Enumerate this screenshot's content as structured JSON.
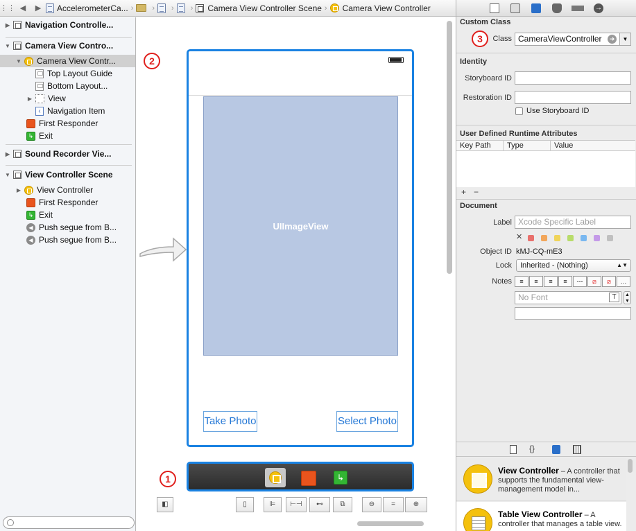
{
  "jumpbar": {
    "items": [
      "AccelerometerCa...",
      "",
      "",
      "",
      "Camera View Controller Scene",
      "Camera View Controller"
    ]
  },
  "outline": {
    "scenes": [
      {
        "label": "Navigation Controlle..."
      },
      {
        "label": "Camera View Contro..."
      },
      {
        "label": "Sound Recorder Vie..."
      },
      {
        "label": "View Controller Scene"
      }
    ],
    "items": {
      "camera_vc": "Camera View Contr...",
      "top_layout": "Top Layout Guide",
      "bottom_layout": "Bottom Layout...",
      "view": "View",
      "nav_item": "Navigation Item",
      "first_responder_1": "First Responder",
      "exit_1": "Exit",
      "view_controller": "View Controller",
      "first_responder_2": "First Responder",
      "exit_2": "Exit",
      "segue_1": "Push segue from B...",
      "segue_2": "Push segue from B..."
    }
  },
  "canvas": {
    "image_view_label": "UIImageView",
    "take_photo": "Take Photo",
    "select_photo": "Select Photo",
    "badges": [
      "1",
      "2",
      "3"
    ]
  },
  "inspector": {
    "custom_class": {
      "heading": "Custom Class",
      "class_label": "Class",
      "class_value": "CameraViewController"
    },
    "identity": {
      "heading": "Identity",
      "storyboard_id_label": "Storyboard ID",
      "storyboard_id_value": "",
      "restoration_id_label": "Restoration ID",
      "restoration_id_value": "",
      "use_storyboard_id": "Use Storyboard ID"
    },
    "runtime_attrs": {
      "heading": "User Defined Runtime Attributes",
      "columns": [
        "Key Path",
        "Type",
        "Value"
      ],
      "add": "+",
      "remove": "−"
    },
    "document": {
      "heading": "Document",
      "label_label": "Label",
      "label_placeholder": "Xcode Specific Label",
      "object_id_label": "Object ID",
      "object_id_value": "kMJ-CQ-mE3",
      "lock_label": "Lock",
      "lock_value": "Inherited - (Nothing)",
      "notes_label": "Notes",
      "font_placeholder": "No Font",
      "swatch_colors": [
        "#e8706c",
        "#f2a65a",
        "#f0d45a",
        "#b8dc6a",
        "#7ab8f0",
        "#c49ae8",
        "#c0c0c0"
      ]
    },
    "library": {
      "items": [
        {
          "title": "View Controller",
          "desc": " – A controller that supports the fundamental view-management model in..."
        },
        {
          "title": "Table View Controller",
          "desc": " – A controller that manages a table view."
        }
      ]
    }
  },
  "colors": {
    "selection_blue": "#1a82e2",
    "image_view_fill": "#b8c8e3",
    "badge_red": "#e0201d"
  }
}
